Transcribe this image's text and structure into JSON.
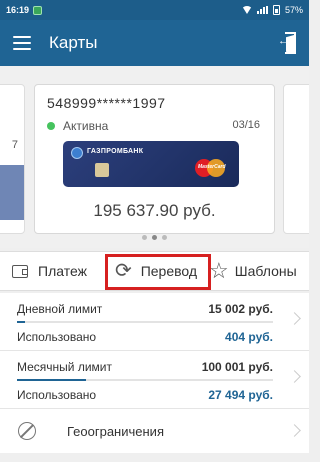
{
  "status_bar": {
    "time": "16:19",
    "battery": "57%"
  },
  "app_bar": {
    "title": "Карты"
  },
  "side_card_left": {
    "fragment": "7"
  },
  "card": {
    "number": "548999******1997",
    "status": "Активна",
    "expiry": "03/16",
    "bank_name": "ГАЗПРОМБАНК",
    "card_brand": "MasterCard",
    "balance": "195 637.90 руб."
  },
  "carousel": {
    "pages": 3,
    "active_page": 1
  },
  "actions": {
    "pay_label": "Платеж",
    "transfer_label": "Перевод",
    "templates_label": "Шаблоны"
  },
  "limits": {
    "daily": {
      "label": "Дневной лимит",
      "limit_value": "15 002 руб.",
      "used_label": "Использовано",
      "used_value": "404 руб.",
      "used_fraction": 0.03
    },
    "monthly": {
      "label": "Месячный лимит",
      "limit_value": "100 001 руб.",
      "used_label": "Использовано",
      "used_value": "27 494 руб.",
      "used_fraction": 0.27
    }
  },
  "geo": {
    "label": "Геоограничения"
  },
  "colors": {
    "primary": "#1f6494",
    "highlight": "#d62020",
    "active": "#46c35e"
  }
}
